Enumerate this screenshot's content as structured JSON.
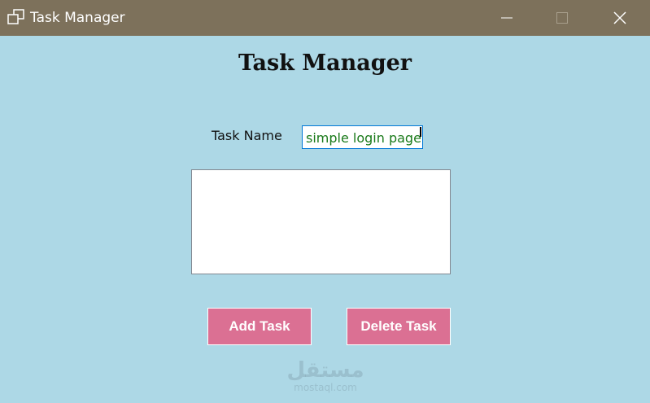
{
  "window": {
    "title": "Task Manager",
    "icons": {
      "app": "app-window-icon",
      "minimize": "minimize-icon",
      "maximize": "maximize-icon",
      "close": "close-icon"
    }
  },
  "form": {
    "heading": "Task Manager",
    "task_name_label": "Task Name",
    "task_name_value": "simple login page",
    "tasks": [],
    "add_button": "Add Task",
    "delete_button": "Delete Task"
  },
  "watermark": {
    "arabic": "مستقل",
    "latin": "mostaql.com"
  },
  "colors": {
    "titlebar": "#7d715b",
    "background": "#add8e6",
    "button": "#db7093",
    "input_text": "#1a7a1a",
    "focus_border": "#0078d7"
  }
}
